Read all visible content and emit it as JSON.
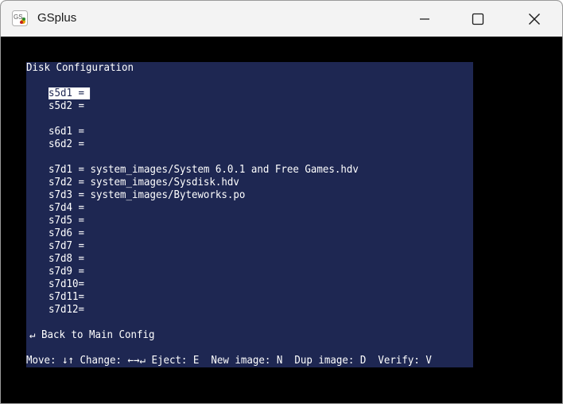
{
  "window": {
    "title": "GSplus",
    "icon": "gsplus-app-icon",
    "controls": [
      "minimize-icon",
      "maximize-icon",
      "close-icon"
    ]
  },
  "screen": {
    "heading": "Disk Configuration",
    "slot5": [
      {
        "drive": "s5d1",
        "line": "s5d1 = ",
        "selected": true
      },
      {
        "drive": "s5d2",
        "line": "s5d2 ="
      }
    ],
    "slot6": [
      {
        "drive": "s6d1",
        "line": "s6d1 ="
      },
      {
        "drive": "s6d2",
        "line": "s6d2 ="
      }
    ],
    "slot7": [
      {
        "drive": "s7d1",
        "line": "s7d1 = system_images/System 6.0.1 and Free Games.hdv"
      },
      {
        "drive": "s7d2",
        "line": "s7d2 = system_images/Sysdisk.hdv"
      },
      {
        "drive": "s7d3",
        "line": "s7d3 = system_images/Byteworks.po"
      },
      {
        "drive": "s7d4",
        "line": "s7d4 ="
      },
      {
        "drive": "s7d5",
        "line": "s7d5 ="
      },
      {
        "drive": "s7d6",
        "line": "s7d6 ="
      },
      {
        "drive": "s7d7",
        "line": "s7d7 ="
      },
      {
        "drive": "s7d8",
        "line": "s7d8 ="
      },
      {
        "drive": "s7d9",
        "line": "s7d9 ="
      },
      {
        "drive": "s7d10",
        "line": "s7d10="
      },
      {
        "drive": "s7d11",
        "line": "s7d11="
      },
      {
        "drive": "s7d12",
        "line": "s7d12="
      }
    ],
    "back": "↵ Back to Main Config",
    "help": "Move: ↓↑ Change: ←→↵ Eject: E  New image: N  Dup image: D  Verify: V"
  }
}
